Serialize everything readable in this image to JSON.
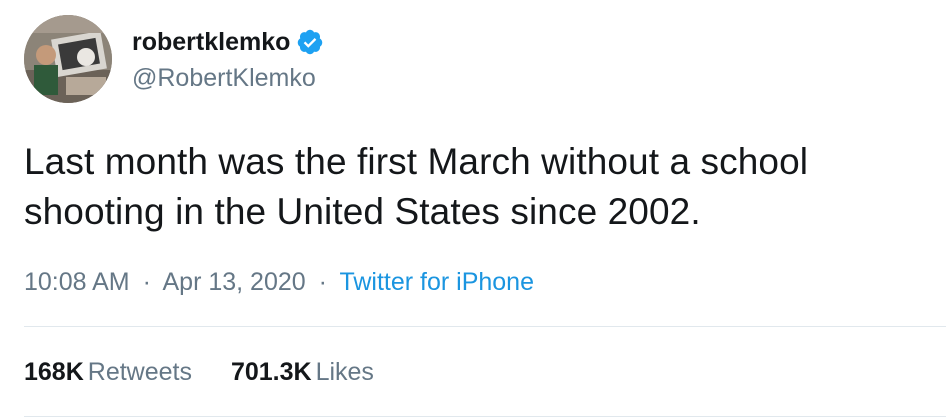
{
  "author": {
    "display_name": "robertklemko",
    "handle": "@RobertKlemko",
    "verified_icon": "verified-badge-icon",
    "avatar_icon": "profile-photo"
  },
  "tweet": {
    "text": "Last month was the first March without a school shooting in the United States since 2002."
  },
  "meta": {
    "time": "10:08 AM",
    "separator": "·",
    "date": "Apr 13, 2020",
    "source": "Twitter for iPhone"
  },
  "stats": {
    "retweets_count": "168K",
    "retweets_label": "Retweets",
    "likes_count": "701.3K",
    "likes_label": "Likes"
  },
  "colors": {
    "text_primary": "#14171a",
    "text_secondary": "#657786",
    "link": "#1b95e0",
    "verified": "#1da1f2",
    "divider": "#e1e8ed"
  }
}
